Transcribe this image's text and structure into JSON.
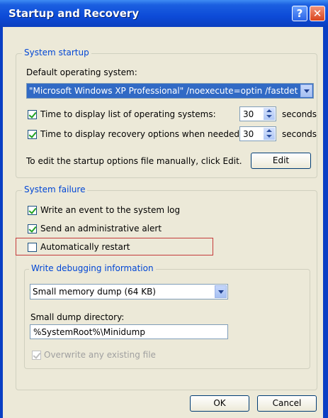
{
  "window": {
    "title": "Startup and Recovery"
  },
  "titlebar_buttons": {
    "help": "?",
    "close": "✕"
  },
  "system_startup": {
    "legend": "System startup",
    "default_os_label": "Default operating system:",
    "default_os_value": "\"Microsoft Windows XP Professional\" /noexecute=optin /fastdete",
    "time_list_label": "Time to display list of operating systems:",
    "time_list_value": "30",
    "time_list_checked": true,
    "time_recovery_label": "Time to display recovery options when needed:",
    "time_recovery_value": "30",
    "time_recovery_checked": true,
    "seconds_label": "seconds",
    "edit_note": "To edit the startup options file manually, click Edit.",
    "edit_button": "Edit"
  },
  "system_failure": {
    "legend": "System failure",
    "write_event_label": "Write an event to the system log",
    "write_event_checked": true,
    "send_alert_label": "Send an administrative alert",
    "send_alert_checked": true,
    "auto_restart_label": "Automatically restart",
    "auto_restart_checked": false
  },
  "debugging": {
    "legend": "Write debugging information",
    "dump_type_value": "Small memory dump (64 KB)",
    "dump_dir_label": "Small dump directory:",
    "dump_dir_value": "%SystemRoot%\\Minidump",
    "overwrite_label": "Overwrite any existing file",
    "overwrite_checked": true,
    "overwrite_disabled": true
  },
  "footer": {
    "ok_button": "OK",
    "cancel_button": "Cancel"
  }
}
